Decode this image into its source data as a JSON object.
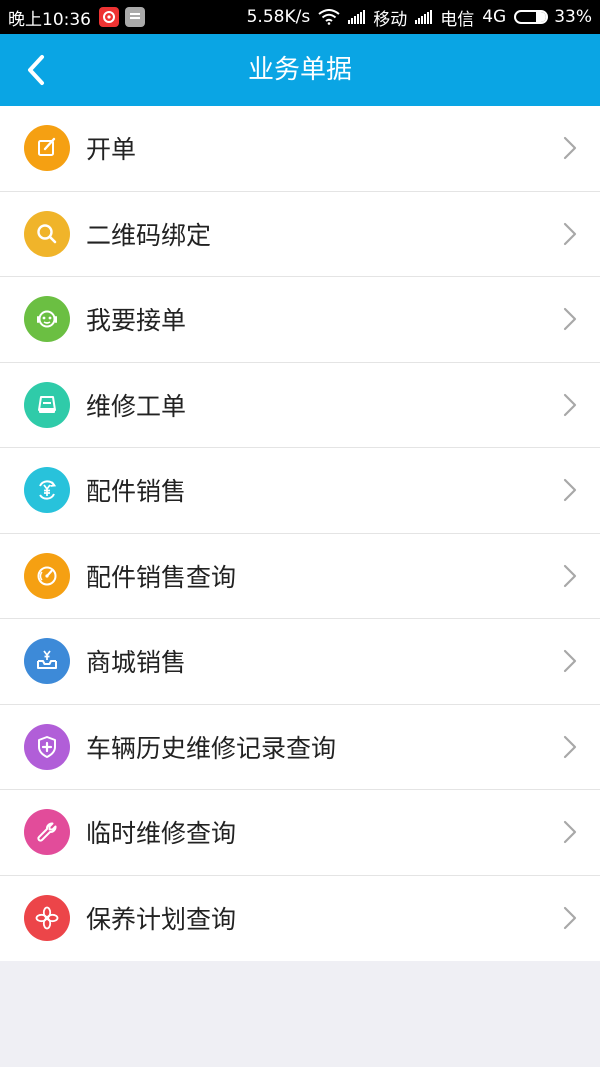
{
  "status_bar": {
    "time": "晚上10:36",
    "net_speed": "5.58K/s",
    "carrier1": "移动",
    "carrier2": "电信",
    "network": "4G",
    "battery": "33%",
    "battery_level": 0.33
  },
  "header": {
    "title": "业务单据"
  },
  "menu": {
    "items": [
      {
        "label": "开单",
        "icon": "edit-icon",
        "color": "#f5a012"
      },
      {
        "label": "二维码绑定",
        "icon": "search-icon",
        "color": "#f0b42a"
      },
      {
        "label": "我要接单",
        "icon": "robot-icon",
        "color": "#6bbf42"
      },
      {
        "label": "维修工单",
        "icon": "drive-icon",
        "color": "#2fcba9"
      },
      {
        "label": "配件销售",
        "icon": "yen-cycle-icon",
        "color": "#28c2db"
      },
      {
        "label": "配件销售查询",
        "icon": "gauge-icon",
        "color": "#f5a012"
      },
      {
        "label": "商城销售",
        "icon": "yen-tray-icon",
        "color": "#3d8ad8"
      },
      {
        "label": "车辆历史维修记录查询",
        "icon": "shield-plus-icon",
        "color": "#b15ed8"
      },
      {
        "label": "临时维修查询",
        "icon": "wrench-icon",
        "color": "#e24c9a"
      },
      {
        "label": "保养计划查询",
        "icon": "flower-icon",
        "color": "#ec4549"
      }
    ]
  }
}
